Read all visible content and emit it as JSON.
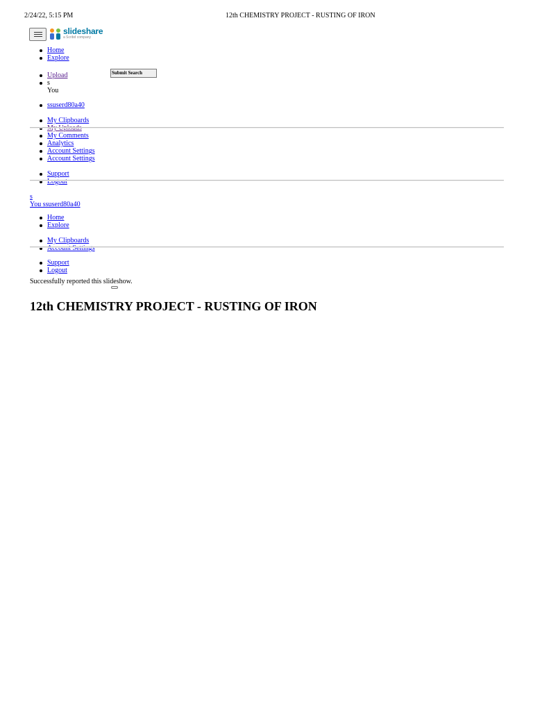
{
  "print_header": {
    "date": "2/24/22, 5:15 PM",
    "title": "12th CHEMISTRY PROJECT - RUSTING OF IRON"
  },
  "brand": {
    "name": "slideshare",
    "tagline": "a Scribd company",
    "colors": {
      "accent": "#0079a3",
      "orange": "#f7941e",
      "green": "#78c043",
      "blue": "#3b6ccf"
    }
  },
  "nav_primary": [
    "Home",
    "Explore"
  ],
  "search": {
    "submit_label": "Submit Search"
  },
  "nav_secondary": {
    "upload": "Upload",
    "initial": "s",
    "you": "You"
  },
  "user": {
    "username": "ssuserd80a40"
  },
  "user_menu": [
    "My Clipboards",
    "My Uploads",
    "My Comments",
    "Analytics",
    "Account Settings",
    "Account Settings"
  ],
  "support_menu": [
    "Support",
    "Logout"
  ],
  "mobile": {
    "initial": "s",
    "you_user": "You ssuserd80a40",
    "nav": [
      "Home",
      "Explore"
    ],
    "user_menu": [
      "My Clipboards",
      "Account Settings"
    ],
    "support_menu": [
      "Support",
      "Logout"
    ]
  },
  "report_message": "Successfully reported this slideshow.",
  "slide_title": "12th CHEMISTRY PROJECT - RUSTING OF IRON"
}
